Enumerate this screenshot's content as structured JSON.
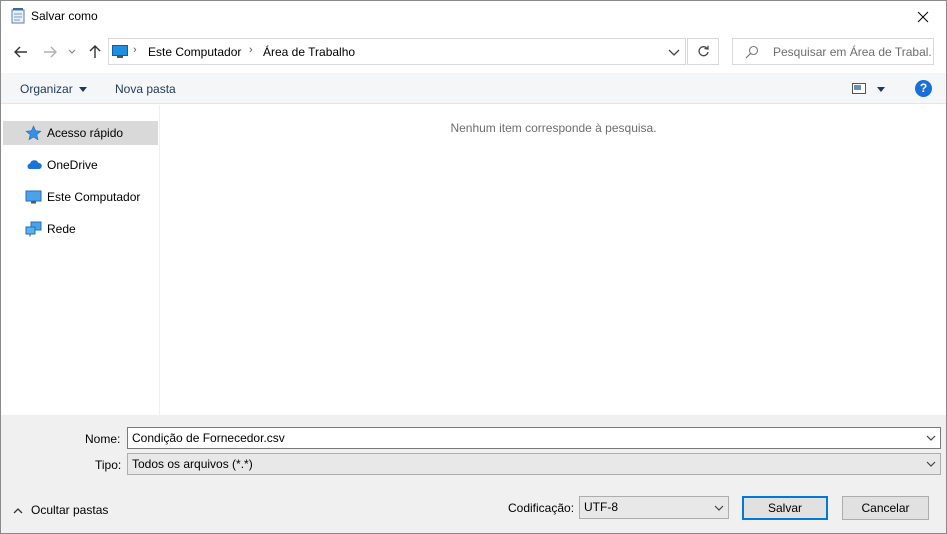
{
  "window": {
    "title": "Salvar como",
    "close_glyph": "✕"
  },
  "address": {
    "crumbs": [
      "Este Computador",
      "Área de Trabalho"
    ],
    "separator": "›",
    "search_placeholder": "Pesquisar em Área de Trabal..."
  },
  "toolbar": {
    "organize_label": "Organizar",
    "new_folder_label": "Nova pasta",
    "help_glyph": "?"
  },
  "nav": {
    "items": [
      {
        "label": "Acesso rápido",
        "icon": "star-icon",
        "selected": true
      },
      {
        "label": "OneDrive",
        "icon": "cloud-icon",
        "selected": false
      },
      {
        "label": "Este Computador",
        "icon": "computer-icon",
        "selected": false
      },
      {
        "label": "Rede",
        "icon": "network-icon",
        "selected": false
      }
    ]
  },
  "content": {
    "empty_message": "Nenhum item corresponde à pesquisa."
  },
  "form": {
    "name_label": "Nome:",
    "name_value": "Condição de Fornecedor.csv",
    "type_label": "Tipo:",
    "type_value": "Todos os arquivos  (*.*)",
    "hide_folders_label": "Ocultar pastas",
    "encoding_label": "Codificação:",
    "encoding_value": "UTF-8",
    "save_label": "Salvar",
    "cancel_label": "Cancelar"
  },
  "colors": {
    "accent": "#0078d7",
    "help": "#1a6fd8",
    "toolbar_text": "#1e395b",
    "selected_bg": "#d9d9d9",
    "footer_bg": "#f0f0f0"
  }
}
